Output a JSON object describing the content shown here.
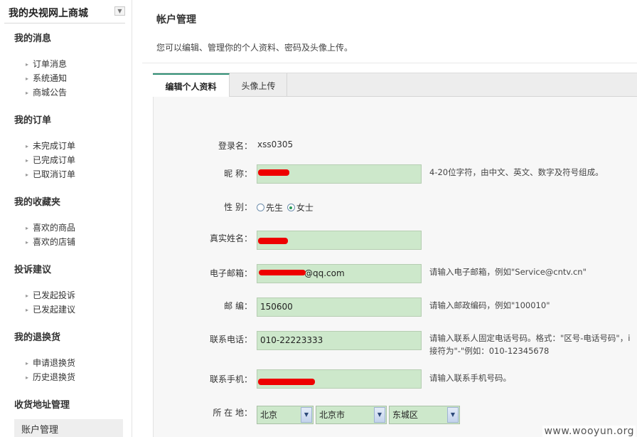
{
  "sidebar": {
    "title": "我的央视网上商城",
    "toggle_icon": "chevron-down-icon",
    "sections": [
      {
        "label": "我的消息",
        "items": [
          "订单消息",
          "系统通知",
          "商城公告"
        ]
      },
      {
        "label": "我的订单",
        "items": [
          "未完成订单",
          "已完成订单",
          "已取消订单"
        ]
      },
      {
        "label": "我的收藏夹",
        "items": [
          "喜欢的商品",
          "喜欢的店铺"
        ]
      },
      {
        "label": "投诉建议",
        "items": [
          "已发起投诉",
          "已发起建议"
        ]
      },
      {
        "label": "我的退换货",
        "items": [
          "申请退换货",
          "历史退换货"
        ]
      },
      {
        "label": "收货地址管理",
        "items": []
      }
    ],
    "active_item": "账户管理"
  },
  "main": {
    "title": "帐户管理",
    "description": "您可以编辑、管理你的个人资料、密码及头像上传。",
    "tabs": [
      {
        "label": "编辑个人资料",
        "active": true
      },
      {
        "label": "头像上传",
        "active": false
      }
    ]
  },
  "form": {
    "login": {
      "label": "登录名：",
      "value": "xss0305"
    },
    "nickname": {
      "label": "昵 称：",
      "value": "",
      "hint": "4-20位字符，由中文、英文、数字及符号组成。"
    },
    "gender": {
      "label": "性 别：",
      "options": [
        "先生",
        "女士"
      ],
      "selected": "女士"
    },
    "realname": {
      "label": "真实姓名：",
      "value": ""
    },
    "email": {
      "label": "电子邮箱：",
      "value": "@qq.com",
      "hint": "请输入电子邮箱，例如\"Service@cntv.cn\""
    },
    "postcode": {
      "label": "邮 编：",
      "value": "150600",
      "hint": "请输入邮政编码，例如\"100010\""
    },
    "phone": {
      "label": "联系电话：",
      "value": "010-22223333",
      "hint_line1": "请输入联系人固定电话号码。格式：\"区号-电话号码\"，i",
      "hint_line2": "接符为\"-\"例如：010-12345678"
    },
    "mobile": {
      "label": "联系手机：",
      "value": "",
      "hint": "请输入联系手机号码。"
    },
    "location": {
      "label": "所 在 地：",
      "province": "北京",
      "city": "北京市",
      "district": "东城区"
    }
  },
  "watermark": "www.wooyun.org",
  "colors": {
    "input_bg": "#cde8cb",
    "tab_accent": "#2f8f74",
    "redaction": "#ee0000"
  }
}
